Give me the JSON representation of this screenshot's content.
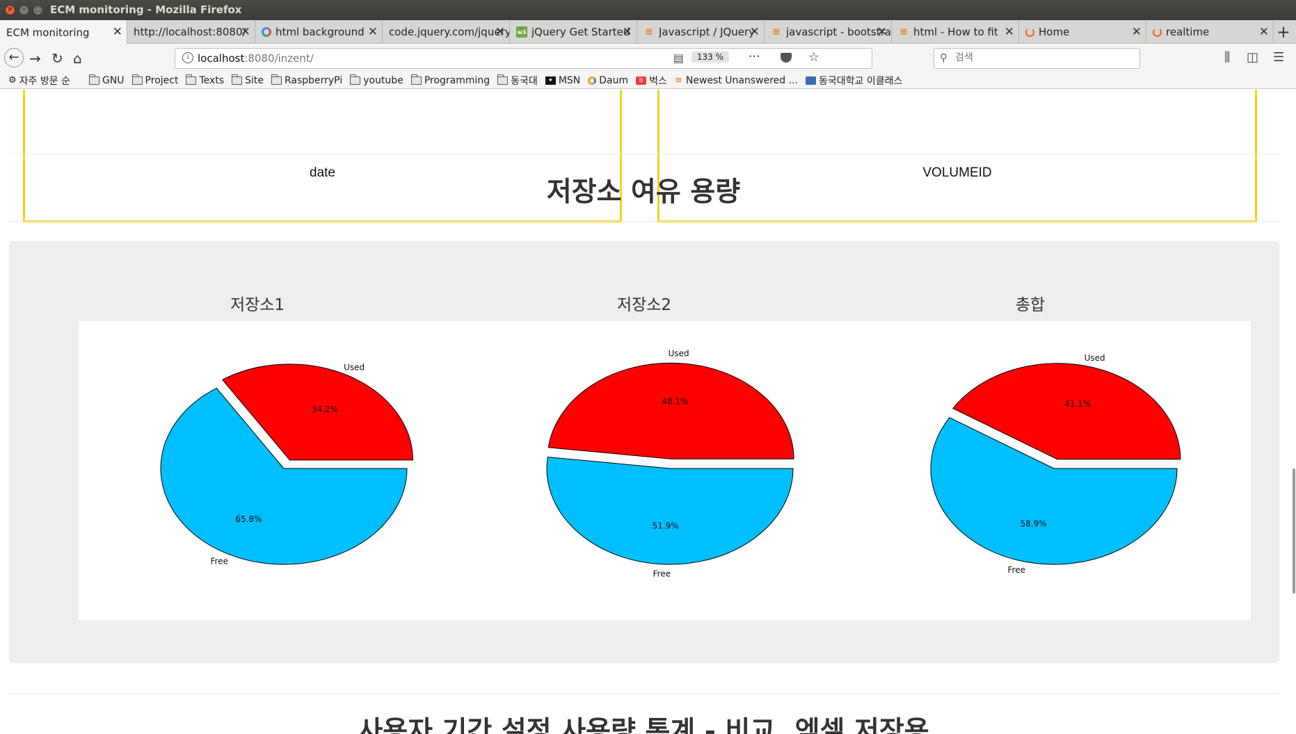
{
  "window": {
    "title": "ECM monitoring - Mozilla Firefox"
  },
  "tabs": [
    {
      "label": "ECM monitoring",
      "icon": "none"
    },
    {
      "label": "http://localhost:8080/",
      "icon": "none"
    },
    {
      "label": "html background",
      "icon": "google-icon"
    },
    {
      "label": "code.jquery.com/jquery",
      "icon": "none"
    },
    {
      "label": "jQuery Get Started",
      "icon": "gear-icon"
    },
    {
      "label": "Javascript / JQuery",
      "icon": "stackoverflow-icon"
    },
    {
      "label": "javascript - bootstrap",
      "icon": "stackoverflow-icon"
    },
    {
      "label": "html - How to fit",
      "icon": "stackoverflow-icon"
    },
    {
      "label": "Home",
      "icon": "ring-icon"
    },
    {
      "label": "realtime",
      "icon": "ring-icon"
    }
  ],
  "toolbar": {
    "url_host": "localhost",
    "url_rest": ":8080/inzent/",
    "zoom": "133 %",
    "search_placeholder": "검색"
  },
  "bookmarks": [
    {
      "label": "자주 방문 순",
      "icon": "gear-icon"
    },
    {
      "label": "GNU",
      "icon": "folder-icon"
    },
    {
      "label": "Project",
      "icon": "folder-icon"
    },
    {
      "label": "Texts",
      "icon": "folder-icon"
    },
    {
      "label": "Site",
      "icon": "folder-icon"
    },
    {
      "label": "RaspberryPi",
      "icon": "folder-icon"
    },
    {
      "label": "youtube",
      "icon": "folder-icon"
    },
    {
      "label": "Programming",
      "icon": "folder-icon"
    },
    {
      "label": "동국대",
      "icon": "folder-icon"
    },
    {
      "label": "MSN",
      "icon": "msn-icon"
    },
    {
      "label": "Daum",
      "icon": "daum-icon"
    },
    {
      "label": "벅스",
      "icon": "bugs-icon"
    },
    {
      "label": "Newest Unanswered ...",
      "icon": "stackoverflow-icon"
    },
    {
      "label": "동국대학교 이클래스",
      "icon": "dgu-icon"
    }
  ],
  "page": {
    "box_left_label": "date",
    "box_right_label": "VOLUMEID",
    "section_title": "저장소 여유 용량",
    "next_section_title": "사용자 기간 설정 사용량 통계 - 비교, 엑셀 저장용"
  },
  "colors": {
    "used": "#ff0000",
    "free": "#00bfff",
    "box_border": "#f4d11e"
  },
  "chart_data": [
    {
      "type": "pie",
      "title": "저장소1",
      "labels": [
        "Used",
        "Free"
      ],
      "values": [
        34.2,
        65.8
      ],
      "value_labels": [
        "34.2%",
        "65.8%"
      ],
      "exploded": "Used"
    },
    {
      "type": "pie",
      "title": "저장소2",
      "labels": [
        "Used",
        "Free"
      ],
      "values": [
        48.1,
        51.9
      ],
      "value_labels": [
        "48.1%",
        "51.9%"
      ],
      "exploded": "Used"
    },
    {
      "type": "pie",
      "title": "총합",
      "labels": [
        "Used",
        "Free"
      ],
      "values": [
        41.1,
        58.9
      ],
      "value_labels": [
        "41.1%",
        "58.9%"
      ],
      "exploded": "Used"
    }
  ]
}
